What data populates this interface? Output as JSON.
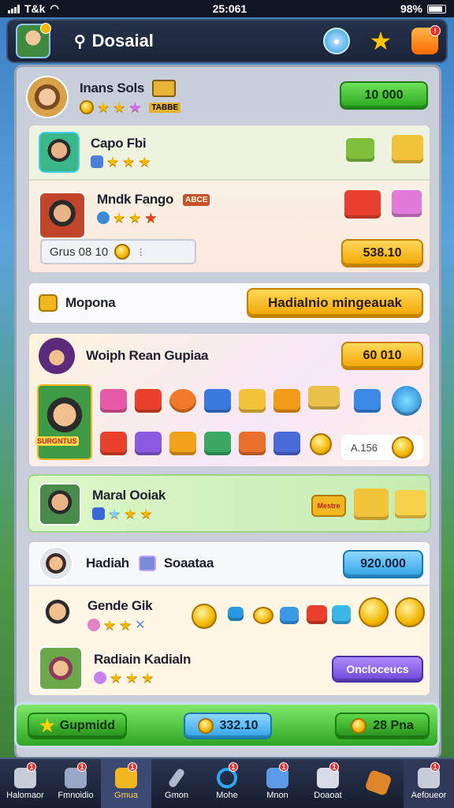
{
  "status_bar": {
    "carrier": "T&k",
    "time": "25:061",
    "battery": "98%"
  },
  "header": {
    "title": "Dosaial",
    "search_icon": "search-icon",
    "icons": [
      "compass-icon",
      "star-icon",
      "gift-icon"
    ]
  },
  "top_card": {
    "name": "Inans Sols",
    "tag": "TABBE",
    "button": "10 000"
  },
  "card2": {
    "row1": {
      "name": "Capo Fbi"
    },
    "row2": {
      "name": "Mndk Fango",
      "tag": "ABCE",
      "field": "Grus 08 10",
      "button": "538.10"
    }
  },
  "section_bar": {
    "label": "Mopona",
    "button": "Hadialnio mingeauak"
  },
  "card3": {
    "name": "Woiph Rean Gupiaa",
    "button": "60 010",
    "badge": "SURGNTUS",
    "counter": "A.156"
  },
  "card4": {
    "name": "Maral Ooiak",
    "tag": "Mestre"
  },
  "card5": {
    "header_name": "Hadiah",
    "header_name2": "Soaataa",
    "button": "920.000",
    "row1": {
      "name": "Gende Gik"
    },
    "row2": {
      "name": "Radiain Kadialn",
      "button": "Oncloceucs"
    }
  },
  "footer": {
    "btn1": "Gupmidd",
    "btn2": "332.10",
    "btn3": "28 Pna"
  },
  "nav": [
    {
      "label": "Halomaor",
      "badge": "1"
    },
    {
      "label": "Fmnoidio",
      "badge": "1"
    },
    {
      "label": "Gmua",
      "badge": "1"
    },
    {
      "label": "Gmon",
      "badge": ""
    },
    {
      "label": "Mohe",
      "badge": "1"
    },
    {
      "label": "Mnon",
      "badge": "1"
    },
    {
      "label": "Doaoat",
      "badge": "1"
    },
    {
      "label": "",
      "badge": ""
    },
    {
      "label": "Aefoueor",
      "badge": "1"
    }
  ]
}
